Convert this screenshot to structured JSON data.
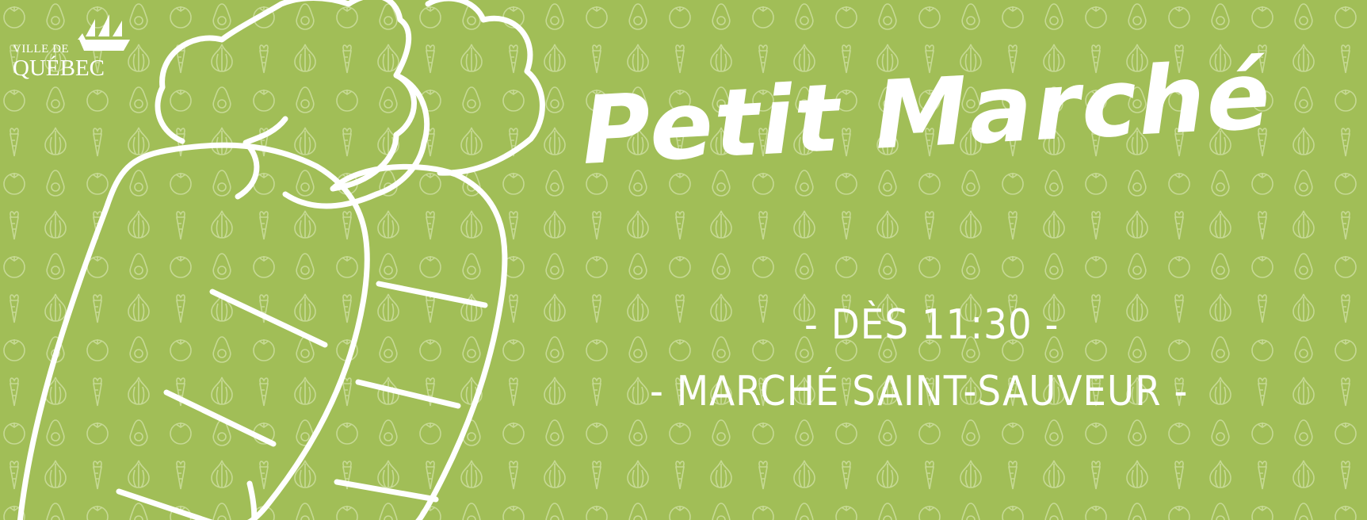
{
  "logo": {
    "line1": "VILLE DE",
    "line2": "QUÉBEC"
  },
  "title": "Petit Marché",
  "time_line": "- DÈS 11:30 -",
  "place_line": "- MARCHÉ SAINT-SAUVEUR -",
  "colors": {
    "background": "#a1be57",
    "foreground": "#ffffff",
    "pattern": "#c6d994"
  },
  "icons": [
    "tomato-icon",
    "avocado-icon",
    "carrot-icon",
    "onion-icon",
    "ship-icon"
  ]
}
